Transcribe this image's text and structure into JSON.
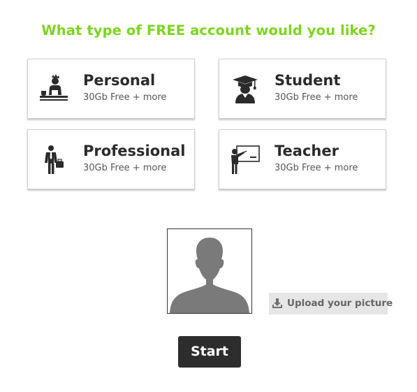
{
  "heading": "What type of FREE account would you like?",
  "colors": {
    "heading": "#7ed321",
    "card_title": "#2b2b2b",
    "icon": "#2b2b2b",
    "start_button_bg": "#2d2d2d",
    "upload_button_bg": "#e6e6e6",
    "avatar_silhouette": "#7a7a7a"
  },
  "account_types": [
    {
      "id": "personal",
      "title": "Personal",
      "subtitle": "30Gb Free + more",
      "icon": "person-at-desk-icon"
    },
    {
      "id": "student",
      "title": "Student",
      "subtitle": "30Gb Free + more",
      "icon": "graduate-cap-icon"
    },
    {
      "id": "professional",
      "title": "Professional",
      "subtitle": "30Gb Free + more",
      "icon": "businessman-briefcase-icon"
    },
    {
      "id": "teacher",
      "title": "Teacher",
      "subtitle": "30Gb Free + more",
      "icon": "teacher-whiteboard-icon"
    }
  ],
  "avatar": {
    "icon": "user-silhouette-icon"
  },
  "upload": {
    "label": "Upload your picture",
    "icon": "download-tray-icon"
  },
  "start": {
    "label": "Start"
  }
}
